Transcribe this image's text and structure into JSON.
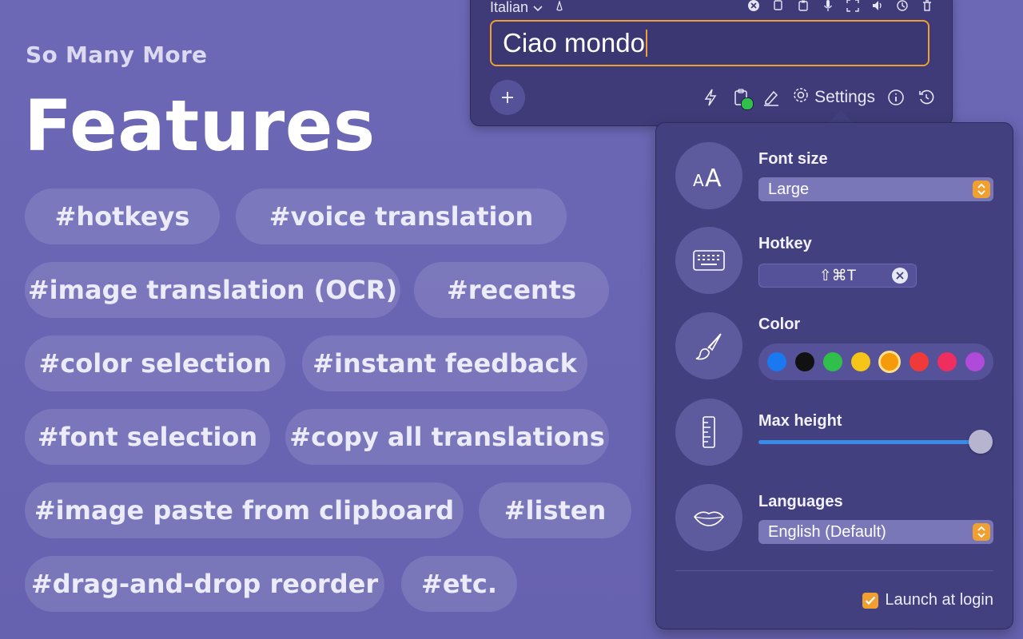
{
  "hero": {
    "subtitle": "So Many More",
    "title": "Features"
  },
  "tags": [
    "#hotkeys",
    "#voice translation",
    "#image translation (OCR)",
    "#recents",
    "#color selection",
    "#instant feedback",
    "#font selection",
    "#copy all translations",
    "#image paste from clipboard",
    "#listen",
    "#drag-and-drop reorder",
    "#etc."
  ],
  "translator": {
    "language": "Italian",
    "input_value": "Ciao mondo",
    "settings_label": "Settings",
    "accent_color": "#f0a030"
  },
  "settings": {
    "font_size": {
      "label": "Font size",
      "value": "Large"
    },
    "hotkey": {
      "label": "Hotkey",
      "value": "⇧⌘T"
    },
    "color": {
      "label": "Color",
      "swatches": [
        "#1a78f0",
        "#111111",
        "#2fbf4a",
        "#f5c518",
        "#f59a0a",
        "#f03a3a",
        "#ee2e5e",
        "#b04ad8"
      ],
      "selected": "#f59a0a"
    },
    "max_height": {
      "label": "Max height",
      "level": 1.0
    },
    "languages": {
      "label": "Languages",
      "value": "English (Default)"
    },
    "launch_at_login": {
      "label": "Launch at login",
      "checked": true
    }
  }
}
